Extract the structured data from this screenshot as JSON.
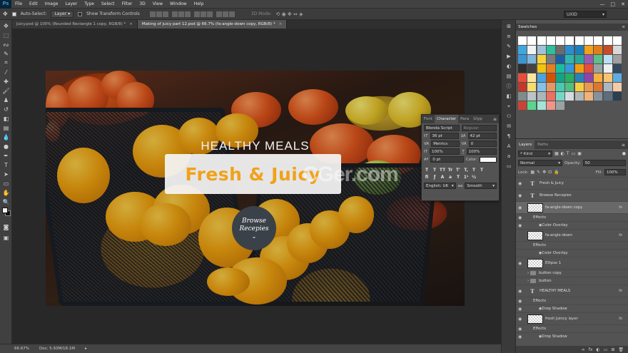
{
  "menubar": {
    "logo": "Ps",
    "items": [
      "File",
      "Edit",
      "Image",
      "Layer",
      "Type",
      "Select",
      "Filter",
      "3D",
      "View",
      "Window",
      "Help"
    ],
    "window_controls": [
      "—",
      "□",
      "✕"
    ]
  },
  "options": {
    "auto_select_label": "Auto-Select:",
    "auto_select_target": "Layer",
    "transform_label": "Show Transform Controls",
    "mode_3d": "3D Mode:",
    "workspace": "UXID"
  },
  "tabs": [
    {
      "label": "Juicy.psd @ 100% (Rounded Rectangle 1 copy, RGB/8) *",
      "active": false
    },
    {
      "label": "Making of juicy part 12.psd @ 66.7% (fa-angle-down copy, RGB/8) *",
      "active": true
    }
  ],
  "canvas": {
    "healthy_meals": "HEALTHY MEALS",
    "hero_title": "Fresh & Juicy",
    "watermark": "CGer.com",
    "browse": "Browse\nRecepies",
    "chevron": "⌄"
  },
  "status": {
    "zoom": "66.67%",
    "doc": "Doc: 5.93M/18.1M"
  },
  "character": {
    "tabs": [
      "Font",
      "Character",
      "Para",
      "Glyp"
    ],
    "active_tab": 1,
    "font_family": "Blenda Script",
    "font_style": "Regular",
    "size": "36 pt",
    "leading": "42 pt",
    "kerning": "Metrics",
    "tracking": "0",
    "vscale": "100%",
    "hscale": "100%",
    "baseline": "0 pt",
    "color_label": "Color:",
    "type_buttons": [
      "T",
      "T",
      "TT",
      "Tr",
      "T'",
      "T,",
      "T",
      "T"
    ],
    "language": "English: UK",
    "antialias": "Smooth"
  },
  "swatches": {
    "title": "Swatches",
    "colors": [
      "#ffffff",
      "#ffffff",
      "#ffffff",
      "#ffffff",
      "#ffffff",
      "#ffffff",
      "#ffffff",
      "#ffffff",
      "#ffffff",
      "#ffffff",
      "#ffffff",
      "#3fa7e0",
      "#f2f2f2",
      "#9ec3d9",
      "#2ebf9c",
      "#6b6b6b",
      "#2a8fd0",
      "#1c7fb8",
      "#f0a21a",
      "#e27d1c",
      "#c84b2a",
      "#d8d8d8",
      "#3a95d3",
      "#7fb6dd",
      "#f7d23c",
      "#7a7a7a",
      "#1a5fa0",
      "#2fb6b3",
      "#26a89a",
      "#9b59b6",
      "#5cc089",
      "#b9e1f2",
      "#a0a0a0",
      "#2e2e2e",
      "#434343",
      "#f1c40f",
      "#e67e22",
      "#1abc9c",
      "#3498db",
      "#f39c12",
      "#e74c3c",
      "#95a5a6",
      "#ecf0f1",
      "#34495e",
      "#e84c3d",
      "#f9e79f",
      "#4aa3df",
      "#d35400",
      "#16a085",
      "#27ae60",
      "#2980b9",
      "#8e44ad",
      "#f5b041",
      "#f8c471",
      "#5dade2",
      "#c0392b",
      "#f7dc6f",
      "#85c1e9",
      "#e59866",
      "#48c9b0",
      "#52be80",
      "#f4d03f",
      "#eb984e",
      "#dc7633",
      "#aeb6bf",
      "#f5cba7",
      "#7f8c8d",
      "#bdc3c7",
      "#aab7b8",
      "#ec7063",
      "#76d7c4",
      "#d6dbdf",
      "#b3b6b7",
      "#f0b27a",
      "#85929e",
      "#5d6d7e",
      "#2c3e50",
      "#cb4335",
      "#58d68d",
      "#a3e4d7",
      "#f1948a",
      "#99a3a4"
    ]
  },
  "layers": {
    "tabs": [
      "Layers",
      "Paths"
    ],
    "filter": "Kind",
    "blend": "Normal",
    "opacity_label": "Opacity:",
    "opacity": "50",
    "lock_label": "Lock:",
    "fill_label": "Fill:",
    "fill": "100%",
    "rows": [
      {
        "type": "text",
        "name": "Fresh & Juicy",
        "indent": 0,
        "fx": false,
        "selected": false,
        "eye": true
      },
      {
        "type": "text",
        "name": "Browse Recepies",
        "indent": 0,
        "fx": false,
        "selected": false,
        "eye": true
      },
      {
        "type": "shape",
        "name": "fa-angle-down copy",
        "indent": 0,
        "fx": true,
        "selected": true,
        "eye": true
      },
      {
        "type": "effects",
        "name": "Effects",
        "indent": 1,
        "fx": false,
        "selected": false,
        "eye": true
      },
      {
        "type": "effect",
        "name": "Color Overlay",
        "indent": 2,
        "fx": false,
        "selected": false,
        "eye": true
      },
      {
        "type": "shape",
        "name": "fa-angle-down",
        "indent": 0,
        "fx": true,
        "selected": false,
        "eye": false
      },
      {
        "type": "effects",
        "name": "Effects",
        "indent": 1,
        "fx": false,
        "selected": false,
        "eye": false
      },
      {
        "type": "effect",
        "name": "Color Overlay",
        "indent": 2,
        "fx": false,
        "selected": false,
        "eye": false
      },
      {
        "type": "shape",
        "name": "Ellipse 1",
        "indent": 0,
        "fx": false,
        "selected": false,
        "eye": true
      },
      {
        "type": "folder",
        "name": "button copy",
        "indent": 0,
        "fx": false,
        "selected": false,
        "eye": false
      },
      {
        "type": "folder",
        "name": "button",
        "indent": 0,
        "fx": false,
        "selected": false,
        "eye": false
      },
      {
        "type": "text",
        "name": "HEALTHY MEALS",
        "indent": 0,
        "fx": true,
        "selected": false,
        "eye": true
      },
      {
        "type": "effects",
        "name": "Effects",
        "indent": 1,
        "fx": false,
        "selected": false,
        "eye": true
      },
      {
        "type": "effect",
        "name": "Drop Shadow",
        "indent": 2,
        "fx": false,
        "selected": false,
        "eye": true
      },
      {
        "type": "shape",
        "name": "fresh Juincy layer",
        "indent": 0,
        "fx": true,
        "selected": false,
        "eye": true
      },
      {
        "type": "effects",
        "name": "Effects",
        "indent": 1,
        "fx": false,
        "selected": false,
        "eye": true
      },
      {
        "type": "effect",
        "name": "Drop Shadow",
        "indent": 2,
        "fx": false,
        "selected": false,
        "eye": true
      }
    ],
    "footer_icons": [
      "∞",
      "fx",
      "◐",
      "▭",
      "⊞",
      "🗑"
    ]
  }
}
